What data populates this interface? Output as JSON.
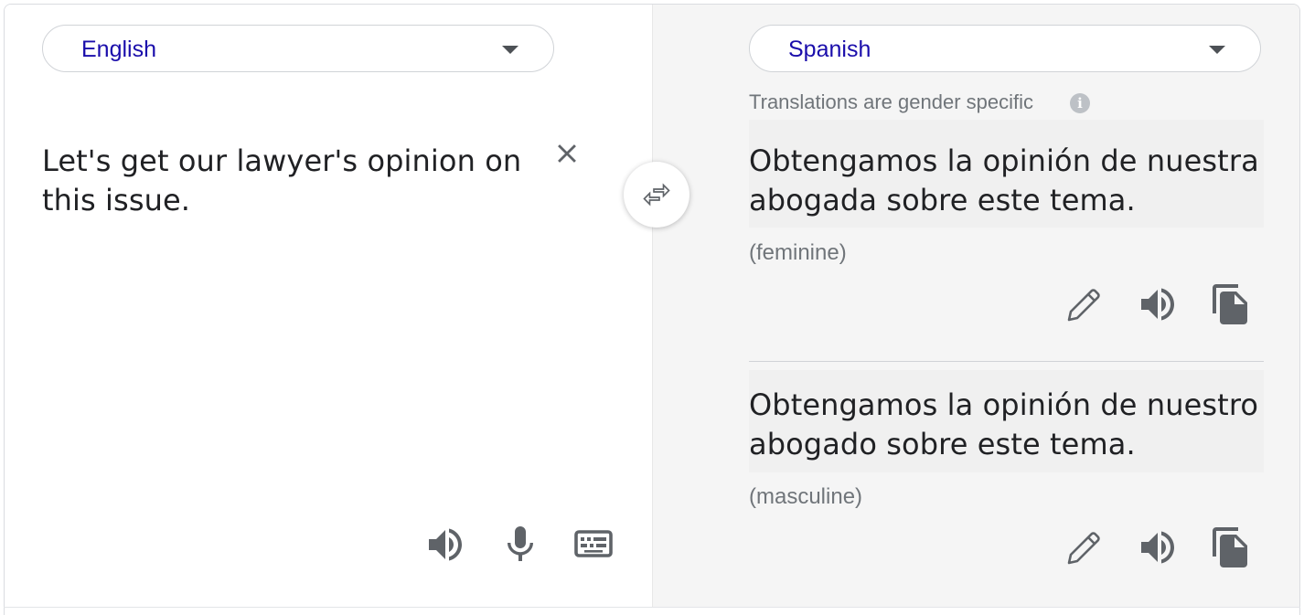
{
  "source": {
    "language": "English",
    "text": "Let's get our lawyer's opinion on this issue."
  },
  "target": {
    "language": "Spanish",
    "gender_note": "Translations are gender specific",
    "info_icon_glyph": "i",
    "translations": [
      {
        "text": "Obtengamos la opinión de nuestra abogada sobre este tema.",
        "gender": "(feminine)"
      },
      {
        "text": "Obtengamos la opinión de nuestro abogado sobre este tema.",
        "gender": "(masculine)"
      }
    ]
  },
  "icons": {
    "clear": "close-icon",
    "swap": "swap-icon",
    "listen": "speaker-icon",
    "mic": "microphone-icon",
    "keyboard": "keyboard-icon",
    "edit": "pencil-icon",
    "copy": "copy-icon"
  },
  "colors": {
    "language_link": "#1a0dab",
    "icon_gray": "#5f6368",
    "muted_text": "#70757a",
    "right_pane_bg": "#f5f5f5"
  }
}
